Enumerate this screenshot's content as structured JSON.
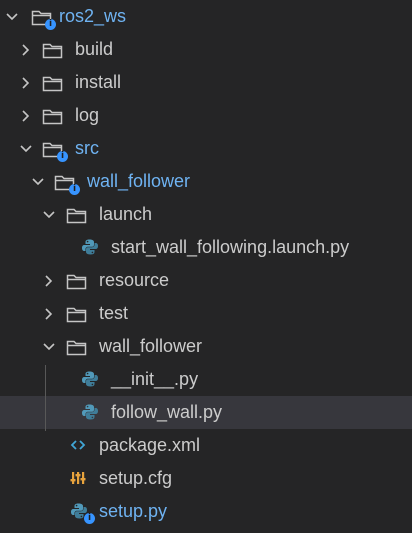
{
  "explorer": {
    "items": [
      {
        "name": "ros2_ws",
        "kind": "folder",
        "state": "expanded",
        "depth": 0,
        "icon": "folder-icon",
        "badge": "i",
        "color": "#6fb3f2"
      },
      {
        "name": "build",
        "kind": "folder",
        "state": "collapsed",
        "depth": 1,
        "icon": "folder-icon"
      },
      {
        "name": "install",
        "kind": "folder",
        "state": "collapsed",
        "depth": 1,
        "icon": "folder-icon"
      },
      {
        "name": "log",
        "kind": "folder",
        "state": "collapsed",
        "depth": 1,
        "icon": "folder-icon"
      },
      {
        "name": "src",
        "kind": "folder",
        "state": "expanded",
        "depth": 1,
        "icon": "folder-icon",
        "badge": "i",
        "color": "#6fb3f2"
      },
      {
        "name": "wall_follower",
        "kind": "folder",
        "state": "expanded",
        "depth": 2,
        "icon": "folder-icon",
        "badge": "i",
        "color": "#6fb3f2"
      },
      {
        "name": "launch",
        "kind": "folder",
        "state": "expanded",
        "depth": 3,
        "icon": "folder-icon"
      },
      {
        "name": "start_wall_following.launch.py",
        "kind": "file",
        "depth": 4,
        "icon": "python-icon"
      },
      {
        "name": "resource",
        "kind": "folder",
        "state": "collapsed",
        "depth": 3,
        "icon": "folder-icon"
      },
      {
        "name": "test",
        "kind": "folder",
        "state": "collapsed",
        "depth": 3,
        "icon": "folder-icon"
      },
      {
        "name": "wall_follower",
        "kind": "folder",
        "state": "expanded",
        "depth": 3,
        "icon": "folder-icon"
      },
      {
        "name": "__init__.py",
        "kind": "file",
        "depth": 4,
        "icon": "python-icon"
      },
      {
        "name": "follow_wall.py",
        "kind": "file",
        "depth": 4,
        "icon": "python-icon",
        "selected": true
      },
      {
        "name": "package.xml",
        "kind": "file",
        "depth": 3,
        "icon": "xml-icon"
      },
      {
        "name": "setup.cfg",
        "kind": "file",
        "depth": 3,
        "icon": "settings-file-icon"
      },
      {
        "name": "setup.py",
        "kind": "file",
        "depth": 3,
        "icon": "python-icon",
        "badge": "i",
        "color": "#6fb3f2"
      }
    ]
  },
  "colors": {
    "background": "#252526",
    "selected_row": "#37373d",
    "text": "#cccccc",
    "info_badge": "#3794ff",
    "python_icon": "#519aba",
    "xml_icon": "#41a7d6",
    "cfg_icon": "#e8a33d"
  }
}
